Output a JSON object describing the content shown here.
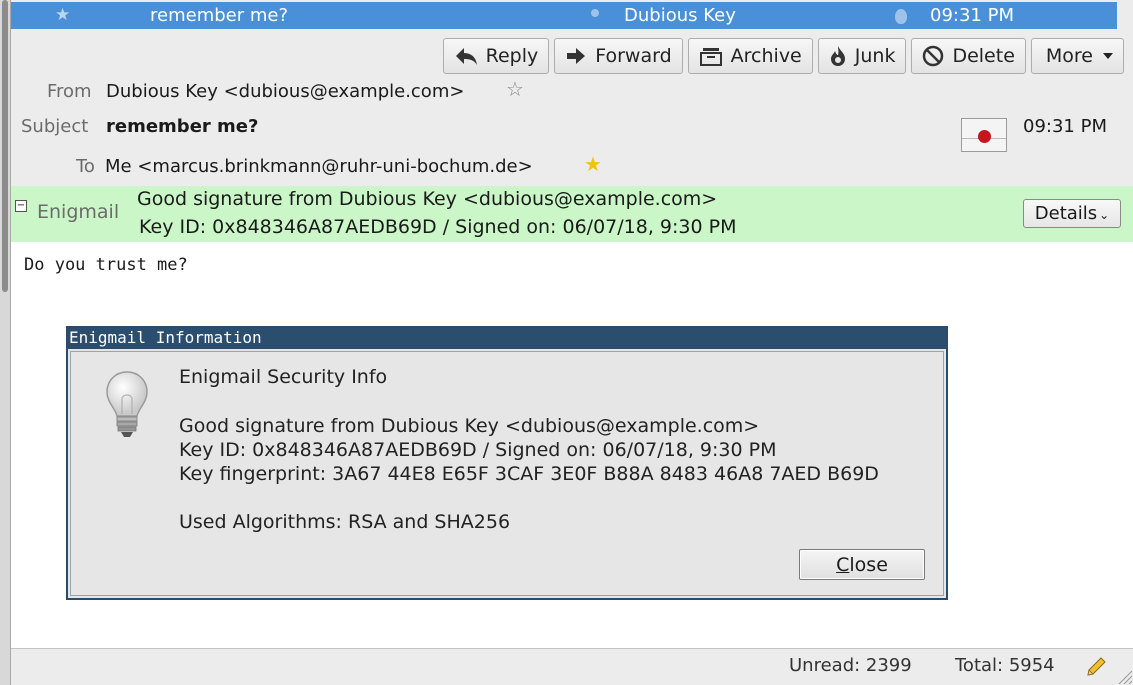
{
  "message_list_row": {
    "subject": "remember me?",
    "sender": "Dubious Key",
    "time": "09:31 PM"
  },
  "toolbar": {
    "reply": "Reply",
    "forward": "Forward",
    "archive": "Archive",
    "junk": "Junk",
    "delete": "Delete",
    "more": "More"
  },
  "header": {
    "from_label": "From",
    "from_value": "Dubious Key <dubious@example.com>",
    "subject_label": "Subject",
    "subject_value": "remember me?",
    "to_label": "To",
    "to_value": "Me <marcus.brinkmann@ruhr-uni-bochum.de>",
    "time": "09:31 PM"
  },
  "enigmail_bar": {
    "label": "Enigmail",
    "line1": "Good signature from Dubious Key <dubious@example.com>",
    "line2": "Key ID: 0x848346A87AEDB69D / Signed on: 06/07/18, 9:30 PM",
    "details_label": "Details",
    "background_color": "#cbf7c8"
  },
  "message_body": {
    "text": "Do you trust me?"
  },
  "dialog": {
    "title": "Enigmail Information",
    "heading": "Enigmail Security Info",
    "signature": "Good signature from Dubious Key <dubious@example.com>",
    "key_id": "Key ID: 0x848346A87AEDB69D / Signed on: 06/07/18, 9:30 PM",
    "fingerprint": "Key fingerprint: 3A67 44E8 E65F 3CAF 3E0F B88A 8483 46A8 7AED B69D",
    "algorithms": "Used Algorithms: RSA and SHA256",
    "close_label_accel": "C",
    "close_label_rest": "lose"
  },
  "statusbar": {
    "unread": "Unread: 2399",
    "total": "Total: 5954"
  },
  "colors": {
    "selection_blue": "#4a90d9",
    "dialog_titlebar": "#2b4d6e",
    "signature_seal": "#c8141c"
  }
}
